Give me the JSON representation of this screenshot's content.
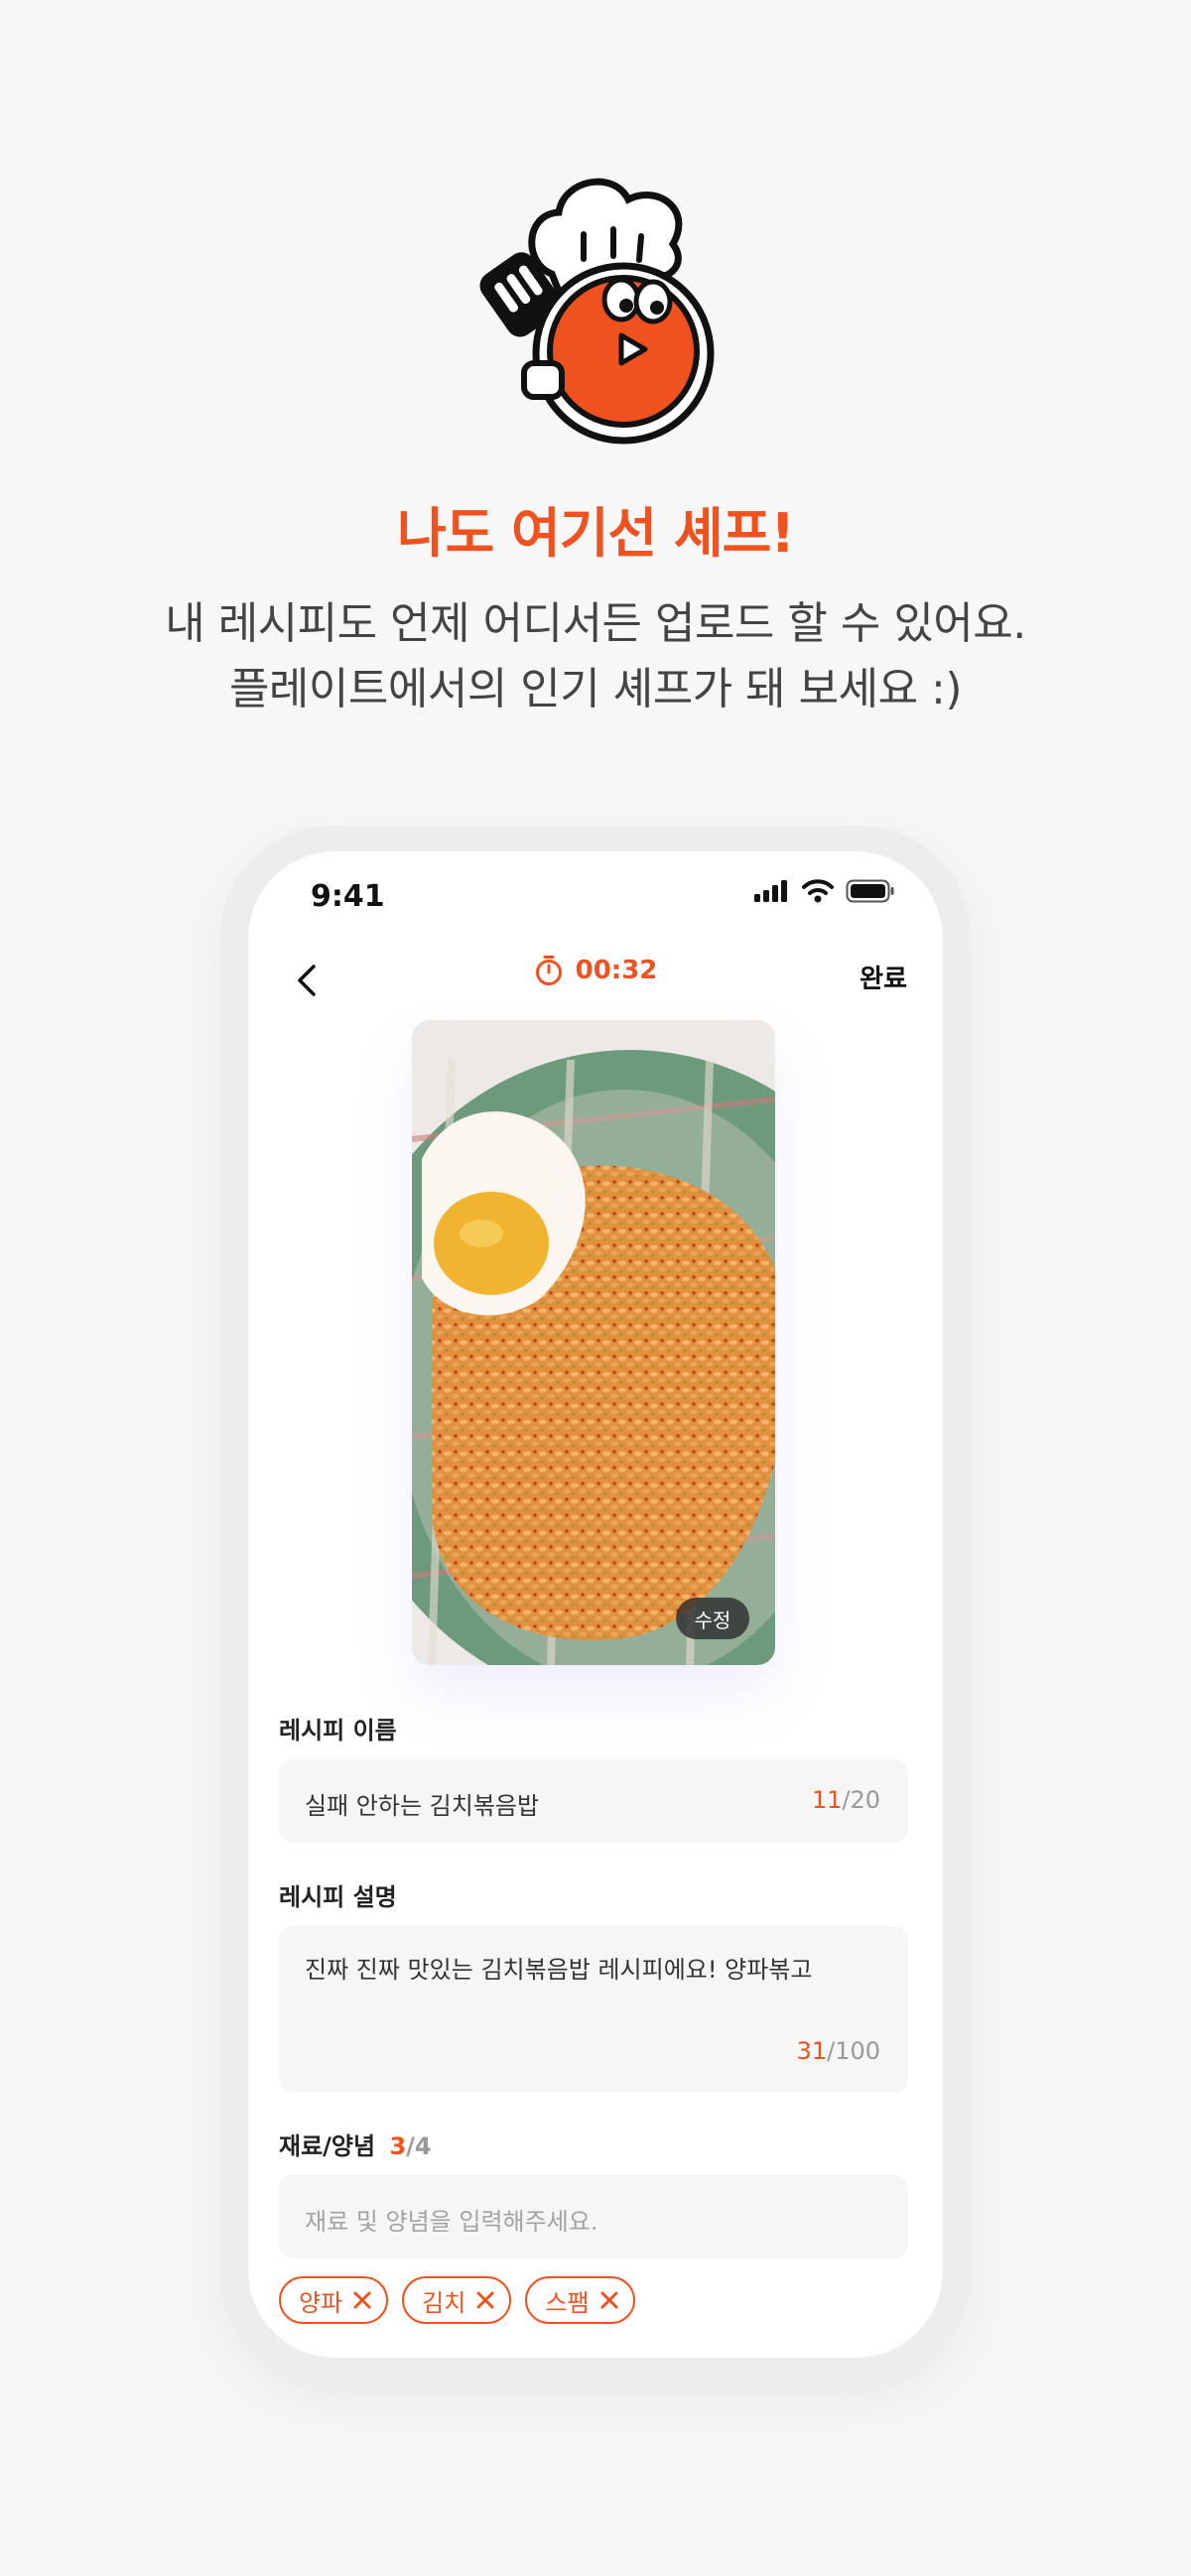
{
  "hero": {
    "headline": "나도 여기선 셰프!",
    "subline_1": "내 레시피도 언제 어디서든 업로드 할 수 있어요.",
    "subline_2": "플레이트에서의 인기 셰프가 돼 보세요 :)"
  },
  "status_bar": {
    "time": "9:41"
  },
  "nav": {
    "timer": "00:32",
    "done_label": "완료"
  },
  "photo": {
    "edit_label": "수정"
  },
  "form": {
    "name_label": "레시피 이름",
    "name_value": "실패 안하는 김치볶음밥",
    "name_count": "11",
    "name_max": "/20",
    "desc_label": "레시피 설명",
    "desc_value": "진짜 진짜 맛있는 김치볶음밥 레시피에요! 양파볶고",
    "desc_count": "31",
    "desc_max": "/100",
    "ingr_label": "재료/양념",
    "ingr_count": "3",
    "ingr_max": "/4",
    "ingr_placeholder": "재료 및 양념을 입력해주세요.",
    "chips": [
      "양파",
      "김치",
      "스팸"
    ]
  },
  "colors": {
    "accent": "#f0521f",
    "background": "#f7f7f7"
  }
}
